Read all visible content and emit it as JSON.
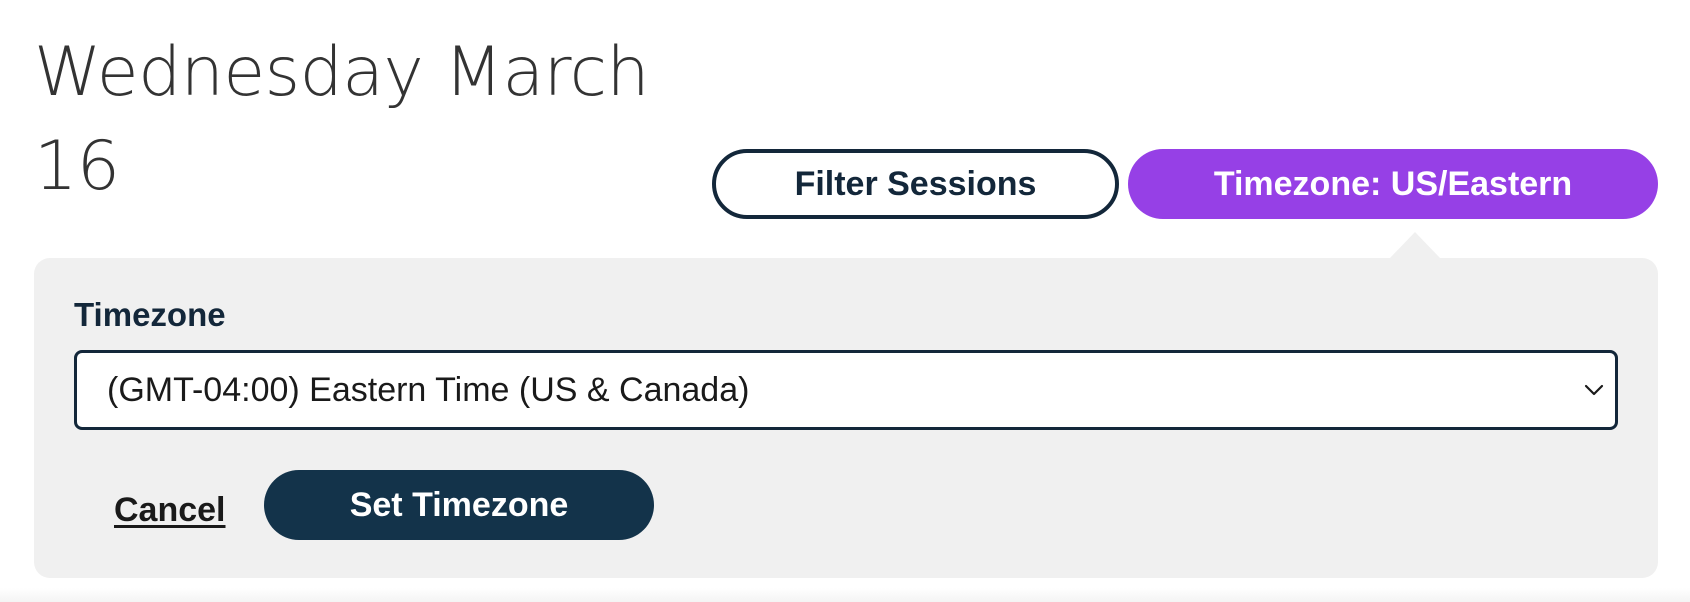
{
  "header": {
    "date_line1": "Wednesday March",
    "date_line2": "16"
  },
  "toolbar": {
    "filter_label": "Filter Sessions",
    "timezone_label": "Timezone: US/Eastern"
  },
  "timezone_panel": {
    "field_label": "Timezone",
    "selected_value": "(GMT-04:00) Eastern Time (US & Canada)",
    "cancel_label": "Cancel",
    "submit_label": "Set Timezone"
  },
  "colors": {
    "accent_purple": "#9640e6",
    "navy": "#13273a",
    "panel_bg": "#f0f0f0"
  },
  "icons": {
    "select_chevron": "chevron-down-icon"
  }
}
